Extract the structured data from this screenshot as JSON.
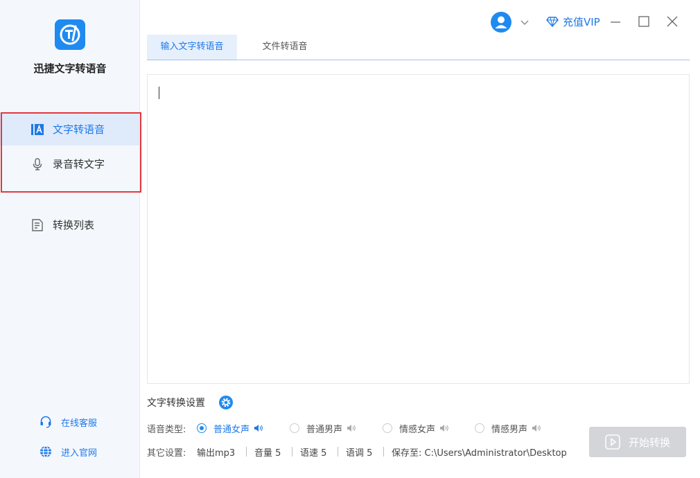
{
  "app": {
    "name": "迅捷文字转语音"
  },
  "sidebar": {
    "items": [
      {
        "label": "文字转语音",
        "icon": "text-a-icon",
        "active": true
      },
      {
        "label": "录音转文字",
        "icon": "microphone-icon",
        "active": false
      },
      {
        "label": "转换列表",
        "icon": "document-list-icon",
        "active": false
      }
    ],
    "footer": [
      {
        "label": "在线客服",
        "icon": "headset-icon"
      },
      {
        "label": "进入官网",
        "icon": "globe-icon"
      }
    ]
  },
  "topbar": {
    "vip_label": "充值VIP",
    "icons": [
      "user-avatar-icon",
      "chevron-down-icon",
      "diamond-icon",
      "minimize-icon",
      "maximize-icon",
      "close-icon"
    ]
  },
  "tabs": [
    {
      "label": "输入文字转语音",
      "active": true
    },
    {
      "label": "文件转语音",
      "active": false
    }
  ],
  "editor": {
    "value": ""
  },
  "settings": {
    "title": "文字转换设置",
    "voice_type_label": "语音类型:",
    "voices": [
      {
        "label": "普通女声",
        "selected": true
      },
      {
        "label": "普通男声",
        "selected": false
      },
      {
        "label": "情感女声",
        "selected": false
      },
      {
        "label": "情感男声",
        "selected": false
      }
    ],
    "other_label": "其它设置:",
    "output": "输出mp3",
    "volume": "音量 5",
    "speed": "语速 5",
    "pitch": "语调 5",
    "save_to": "保存至: C:\\Users\\Administrator\\Desktop"
  },
  "start_button": {
    "label": "开始转换",
    "enabled": false
  },
  "colors": {
    "accent": "#1f8bf0",
    "sidebar_bg": "#f4f8fd",
    "highlight_border": "#e2383d",
    "disabled_button": "#d3d5d9"
  }
}
